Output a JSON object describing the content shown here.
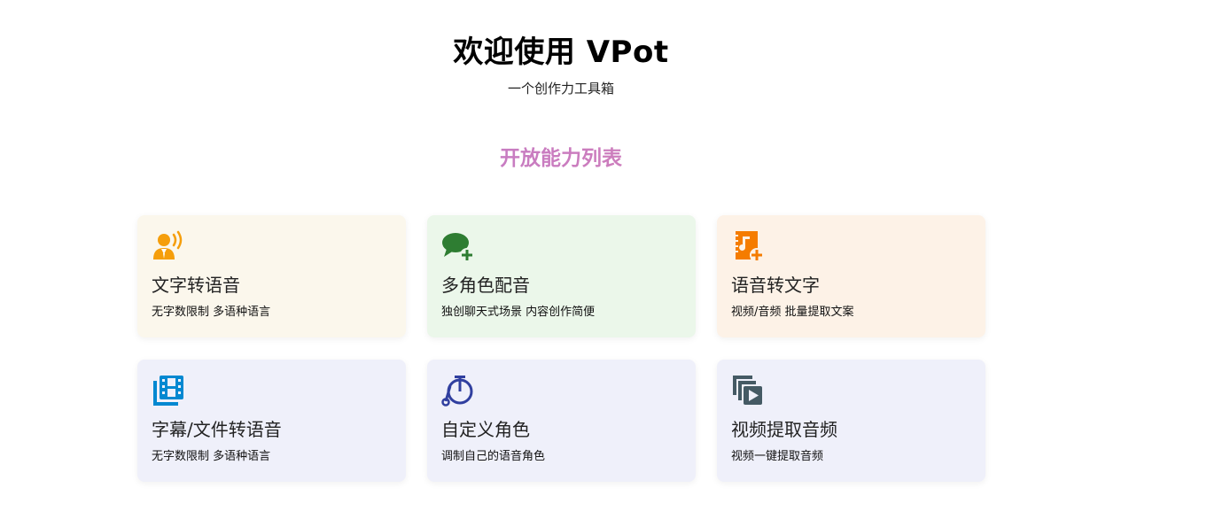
{
  "hero": {
    "title": "欢迎使用 VPot",
    "subtitle": "一个创作力工具箱"
  },
  "section": {
    "title": "开放能力列表"
  },
  "cards": [
    {
      "title": "文字转语音",
      "desc": "无字数限制 多语种语言",
      "icon": "speaking-person-icon",
      "bg": "#fbf7ec",
      "icon_color": "#f59e0b"
    },
    {
      "title": "多角色配音",
      "desc": "独创聊天式场景 内容创作简便",
      "icon": "chat-add-icon",
      "bg": "#ebf7ea",
      "icon_color": "#2e7d32"
    },
    {
      "title": "语音转文字",
      "desc": "视频/音频 批量提取文案",
      "icon": "audio-file-add-icon",
      "bg": "#fdf2e7",
      "icon_color": "#f57c00"
    },
    {
      "title": "字幕/文件转语音",
      "desc": "无字数限制 多语种语言",
      "icon": "film-strip-icon",
      "bg": "#eff0fa",
      "icon_color": "#0288d1"
    },
    {
      "title": "自定义角色",
      "desc": "调制自己的语音角色",
      "icon": "penny-farthing-icon",
      "bg": "#eff0fa",
      "icon_color": "#303f9f"
    },
    {
      "title": "视频提取音频",
      "desc": "视频一键提取音频",
      "icon": "video-library-icon",
      "bg": "#eff0fa",
      "icon_color": "#455a64"
    }
  ]
}
